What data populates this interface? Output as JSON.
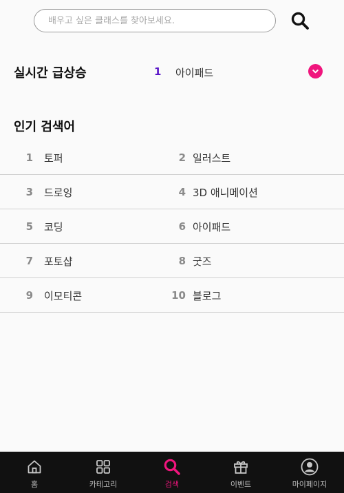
{
  "search": {
    "placeholder": "배우고 싶은 클래스를 찾아보세요.",
    "value": ""
  },
  "realtime": {
    "title": "실시간 급상승",
    "rank": "1",
    "term": "아이패드"
  },
  "popular": {
    "title": "인기 검색어",
    "items": [
      {
        "rank": "1",
        "term": "토퍼"
      },
      {
        "rank": "2",
        "term": "일러스트"
      },
      {
        "rank": "3",
        "term": "드로잉"
      },
      {
        "rank": "4",
        "term": "3D 애니메이션"
      },
      {
        "rank": "5",
        "term": "코딩"
      },
      {
        "rank": "6",
        "term": "아이패드"
      },
      {
        "rank": "7",
        "term": "포토샵"
      },
      {
        "rank": "8",
        "term": "굿즈"
      },
      {
        "rank": "9",
        "term": "이모티콘"
      },
      {
        "rank": "10",
        "term": "블로그"
      }
    ]
  },
  "nav": {
    "items": [
      {
        "label": "홈",
        "icon": "home-icon"
      },
      {
        "label": "카테고리",
        "icon": "grid-icon"
      },
      {
        "label": "검색",
        "icon": "search-icon",
        "active": true
      },
      {
        "label": "이벤트",
        "icon": "gift-icon"
      },
      {
        "label": "마이페이지",
        "icon": "user-icon"
      }
    ]
  },
  "colors": {
    "accent": "#f0157d",
    "realtime_rank": "#5a17c8",
    "nav_bg": "#111111",
    "background": "#fafafa"
  }
}
